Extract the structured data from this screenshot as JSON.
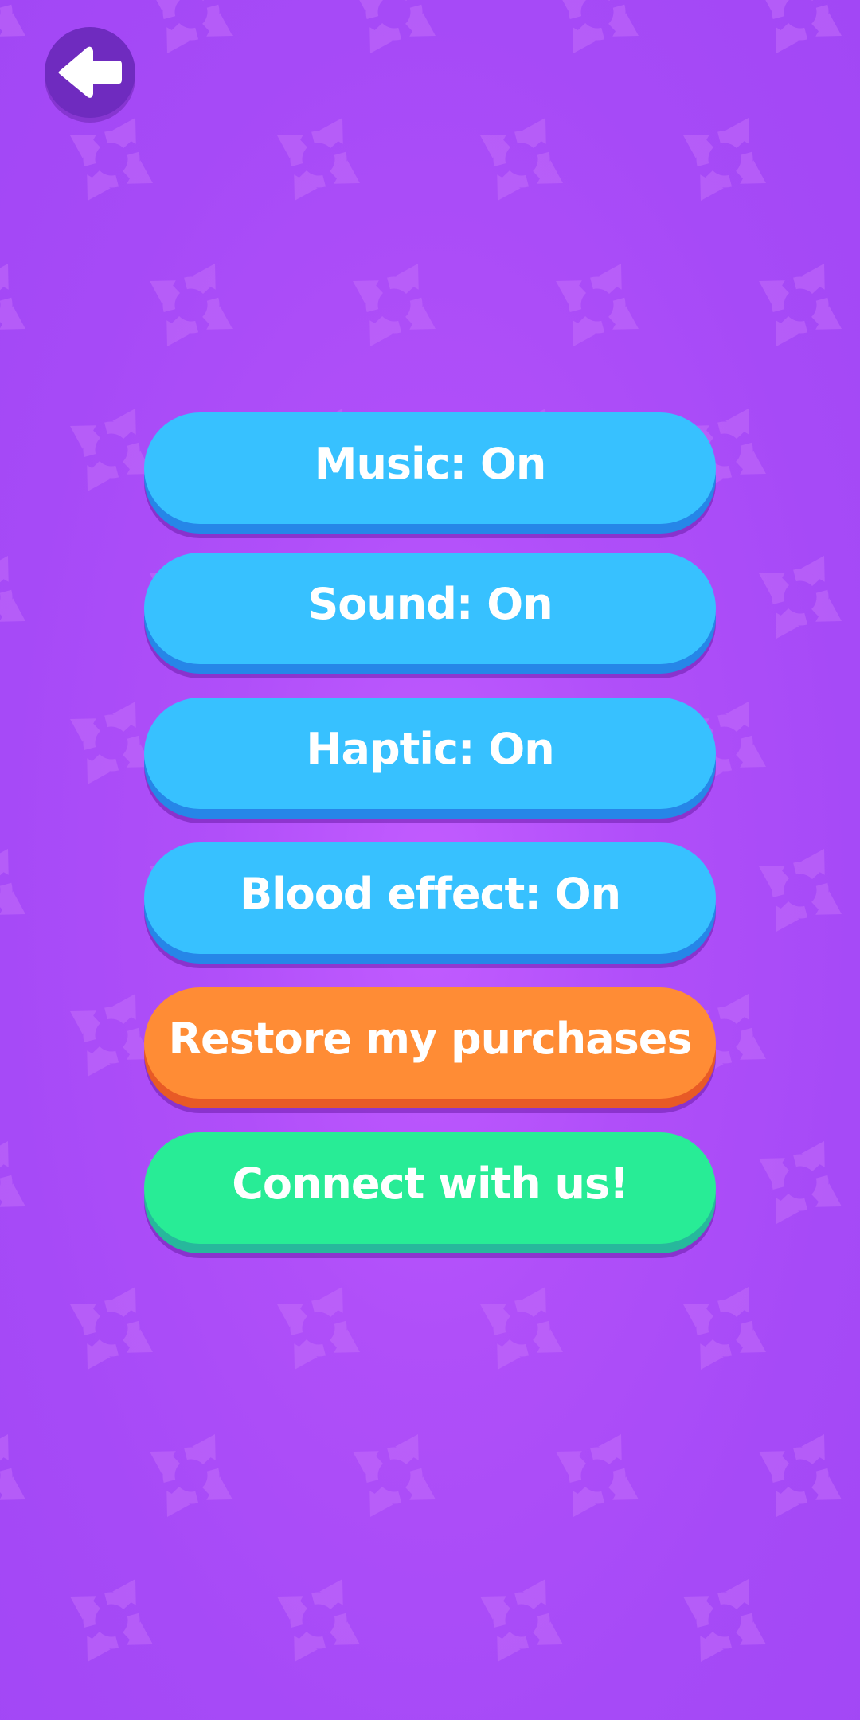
{
  "background": {
    "color": "#a64af7",
    "pattern_icon": "rotating-arrows-icon",
    "pattern_color": "#c36dfa"
  },
  "header": {
    "back_icon": "arrow-left-icon",
    "back_button_color": "#6f2bbf"
  },
  "menu": {
    "music_label": "Music: On",
    "sound_label": "Sound: On",
    "haptic_label": "Haptic: On",
    "blood_label": "Blood effect: On",
    "restore_label": "Restore my purchases",
    "connect_label": "Connect with us!"
  },
  "colors": {
    "toggle_button": "#37c1ff",
    "restore_button": "#ff8c35",
    "connect_button": "#28ec96",
    "text": "#ffffff"
  }
}
